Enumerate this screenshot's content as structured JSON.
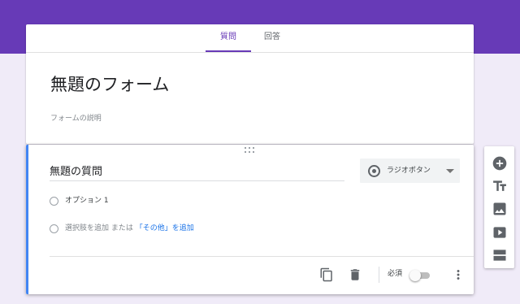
{
  "tabs": [
    {
      "label": "質問",
      "active": true
    },
    {
      "label": "回答",
      "active": false
    }
  ],
  "form": {
    "title": "無題のフォーム",
    "description_placeholder": "フォームの説明"
  },
  "question": {
    "title": "無題の質問",
    "type_label": "ラジオボタン",
    "options": [
      "オプション 1"
    ],
    "add_option_prefix": "選択肢を追加 または ",
    "add_other_link": "「その他」を追加",
    "required_label": "必須",
    "required": false
  },
  "side_toolbar": {
    "icons": [
      "add-question-icon",
      "add-title-icon",
      "add-image-icon",
      "add-video-icon",
      "add-section-icon"
    ]
  },
  "colors": {
    "accent": "#673ab7",
    "background": "#f0ebf8",
    "question_accent": "#4285f4",
    "link": "#1a73e8"
  }
}
